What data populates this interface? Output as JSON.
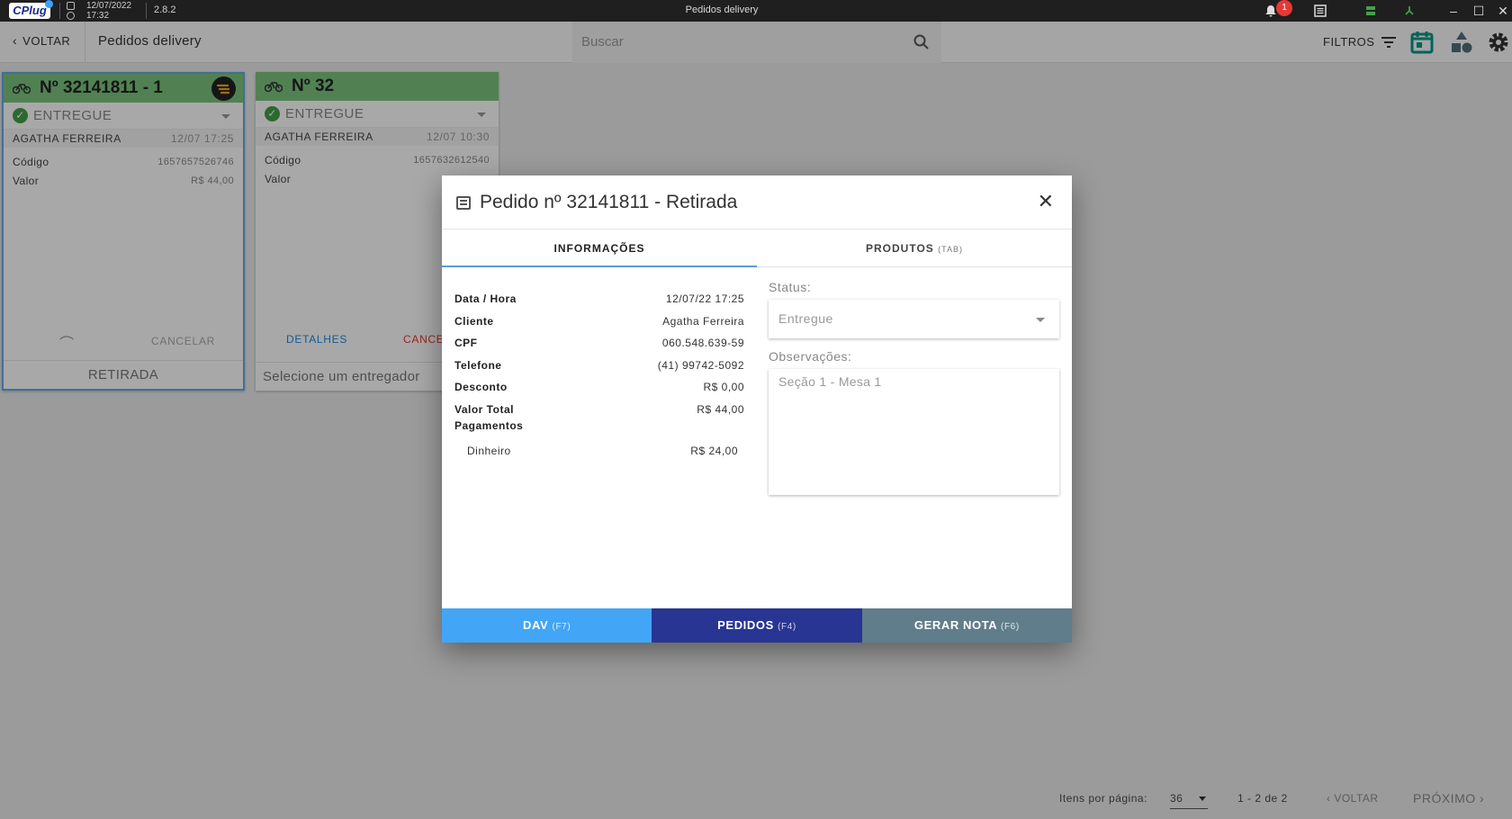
{
  "titlebar": {
    "logo": "CPlug",
    "date": "12/07/2022",
    "time": "17:32",
    "version": "2.8.2",
    "window_title": "Pedidos delivery",
    "notification_count": "1"
  },
  "toolbar": {
    "back_label": "VOLTAR",
    "page_title": "Pedidos delivery",
    "search_placeholder": "Buscar",
    "filters_label": "FILTROS"
  },
  "cards": [
    {
      "number": "Nº 32141811 - 1",
      "status": "ENTREGUE",
      "customer": "AGATHA FERREIRA",
      "datetime": "12/07 17:25",
      "code_label": "Código",
      "code": "1657657526746",
      "value_label": "Valor",
      "value": "R$ 44,00",
      "cancel_label": "CANCELAR",
      "footer": "RETIRADA"
    },
    {
      "number": "Nº 32",
      "status": "ENTREGUE",
      "customer": "AGATHA FERREIRA",
      "datetime": "12/07 10:30",
      "code_label": "Código",
      "code": "1657632612540",
      "value_label": "Valor",
      "details_label": "DETALHES",
      "cancel_label": "CANCE",
      "footer": "Selecione um entregador"
    }
  ],
  "modal": {
    "title": "Pedido nº 32141811 - Retirada",
    "tabs": [
      {
        "label": "INFORMAÇÕES",
        "hint": ""
      },
      {
        "label": "PRODUTOS",
        "hint": "(TAB)"
      }
    ],
    "info": [
      {
        "key": "Data / Hora",
        "value": "12/07/22 17:25"
      },
      {
        "key": "Cliente",
        "value": "Agatha Ferreira"
      },
      {
        "key": "CPF",
        "value": "060.548.639-59"
      },
      {
        "key": "Telefone",
        "value": "(41) 99742-5092"
      },
      {
        "key": "Desconto",
        "value": "R$ 0,00"
      },
      {
        "key": "Valor Total",
        "value": "R$ 44,00"
      }
    ],
    "payments_label": "Pagamentos",
    "payments": [
      {
        "method": "Dinheiro",
        "amount": "R$ 24,00"
      }
    ],
    "status_label": "Status:",
    "status_value": "Entregue",
    "notes_label": "Observações:",
    "notes_value": "Seção 1 - Mesa 1",
    "buttons": [
      {
        "label": "DAV",
        "key": "(F7)",
        "color": "#42a5f5"
      },
      {
        "label": "PEDIDOS",
        "key": "(F4)",
        "color": "#283593"
      },
      {
        "label": "GERAR NOTA",
        "key": "(F6)",
        "color": "#607d8b"
      }
    ]
  },
  "pagination": {
    "per_page_label": "Itens por página:",
    "per_page_value": "36",
    "range": "1 - 2 de 2",
    "prev_label": "VOLTAR",
    "next_label": "PRÓXIMO"
  },
  "colors": {
    "card_header": "#7cc47e",
    "accent_blue": "#5a9be6",
    "status_green": "#43a047"
  }
}
